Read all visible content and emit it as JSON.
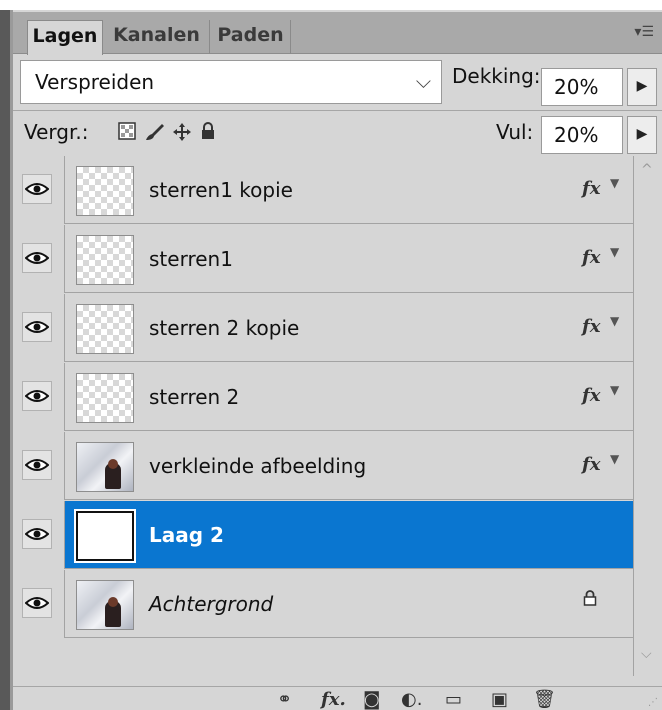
{
  "tabs": [
    "Lagen",
    "Kanalen",
    "Paden"
  ],
  "blend_mode": "Verspreiden",
  "opacity": {
    "label": "Dekking:",
    "value": "20%"
  },
  "fill": {
    "label": "Vul:",
    "value": "20%"
  },
  "lock_label": "Vergr.:",
  "layers": [
    {
      "name": "sterren1 kopie",
      "thumbnail": "transparent",
      "fx": "fx"
    },
    {
      "name": "sterren1",
      "thumbnail": "transparent",
      "fx": "fx"
    },
    {
      "name": "sterren 2 kopie",
      "thumbnail": "transparent",
      "fx": "fx"
    },
    {
      "name": "sterren 2",
      "thumbnail": "transparent",
      "fx": "fx"
    },
    {
      "name": "verkleinde afbeelding",
      "thumbnail": "photo",
      "fx": "fx"
    },
    {
      "name": "Laag 2",
      "thumbnail": "white",
      "selected": true
    },
    {
      "name": "Achtergrond",
      "thumbnail": "photo",
      "locked": true
    }
  ],
  "colors": {
    "selected": "#0a76d0",
    "panel": "#d6d6d6",
    "tabbar": "#a9a9a9"
  },
  "icons": [
    "eye-icon",
    "lock-transparent-icon",
    "brush-icon",
    "move-icon",
    "lock-icon",
    "link-icon",
    "fx-icon",
    "mask-icon",
    "adjustment-icon",
    "folder-icon",
    "new-layer-icon",
    "trash-icon"
  ]
}
